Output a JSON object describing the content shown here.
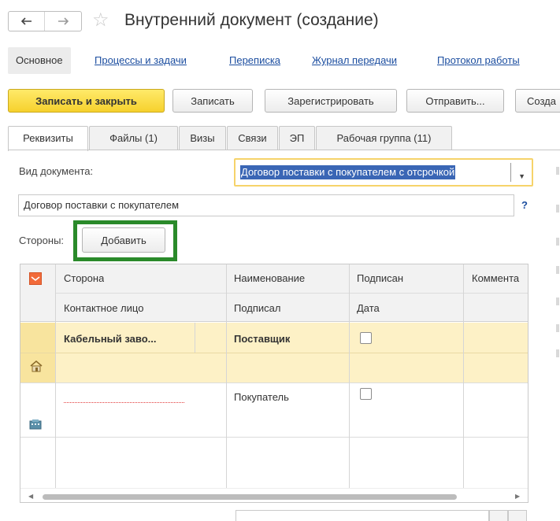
{
  "window": {
    "title": "Внутренний документ (создание)",
    "back_icon": "arrow-left-icon",
    "forward_icon": "arrow-right-icon",
    "favorite_icon": "star-icon"
  },
  "section_tabs": [
    {
      "label": "Основное",
      "active": true
    },
    {
      "label": "Процессы и задачи",
      "active": false
    },
    {
      "label": "Переписка",
      "active": false
    },
    {
      "label": "Журнал передачи",
      "active": false
    },
    {
      "label": "Протокол работы",
      "active": false
    }
  ],
  "toolbar": {
    "save_close": "Записать и закрыть",
    "save": "Записать",
    "register": "Зарегистрировать",
    "send": "Отправить...",
    "create": "Созда"
  },
  "tabs": [
    {
      "label": "Реквизиты",
      "active": true
    },
    {
      "label": "Файлы (1)",
      "active": false
    },
    {
      "label": "Визы",
      "active": false
    },
    {
      "label": "Связи",
      "active": false
    },
    {
      "label": "ЭП",
      "active": false
    },
    {
      "label": "Рабочая группа (11)",
      "active": false
    }
  ],
  "form": {
    "doctype_label": "Вид документа:",
    "doctype_value": "Договор поставки с покупателем с отсрочкой",
    "name_value": "Договор поставки с покупателем",
    "help": "?",
    "parties_label": "Стороны:",
    "add_button": "Добавить"
  },
  "grid": {
    "headers_row1": [
      "Сторона",
      "Наименование",
      "Подписан",
      "Коммента"
    ],
    "headers_row2": [
      "Контактное лицо",
      "Подписал",
      "Дата"
    ],
    "rows": [
      {
        "party": "Кабельный заво...",
        "role": "Поставщик",
        "signed": false,
        "icon": "house-icon"
      },
      {
        "party": "",
        "role": "Покупатель",
        "signed": false,
        "icon": "building-icon"
      }
    ]
  },
  "colors": {
    "accent_yellow": "#f6d12d",
    "link_blue": "#1c4ea0",
    "selection_blue": "#3a66b5",
    "highlight_green": "#2a8a2a",
    "selected_row": "#fdf1c6"
  }
}
